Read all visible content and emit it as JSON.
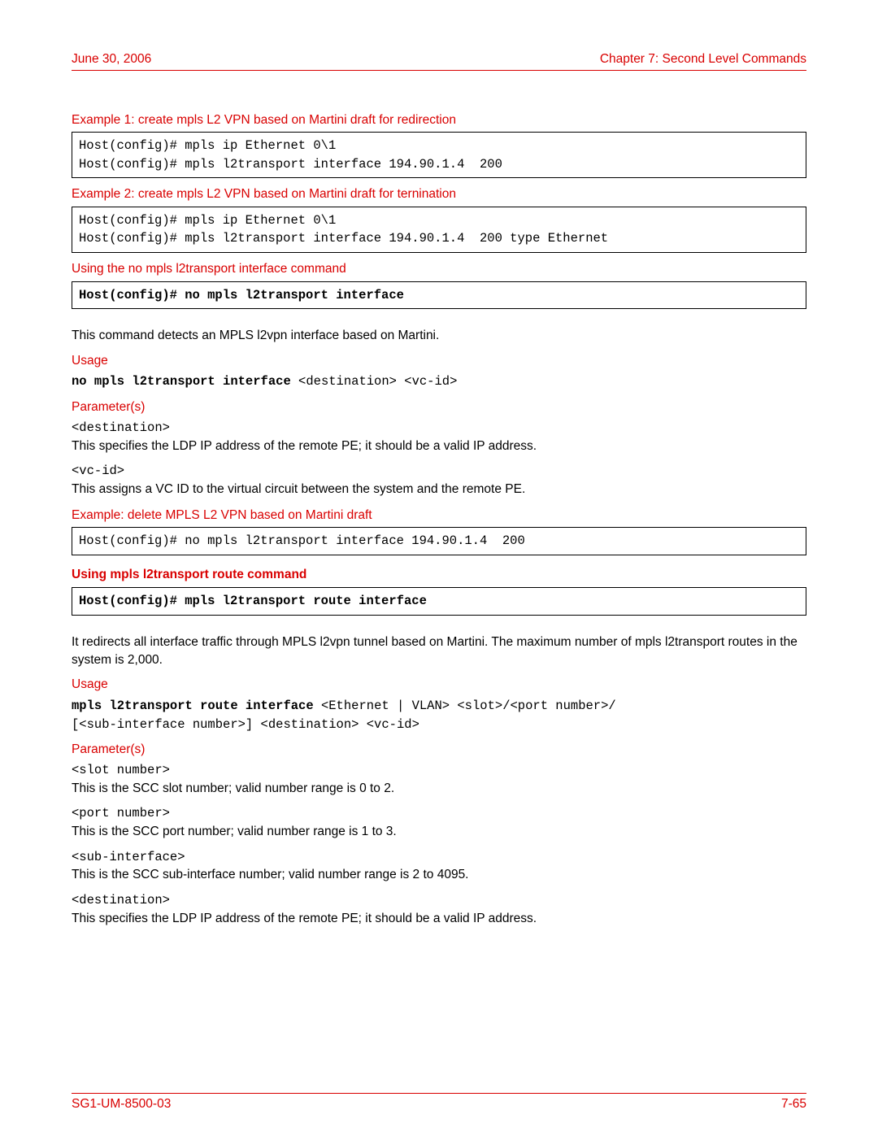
{
  "header": {
    "left": "June 30, 2006",
    "right": "Chapter 7: Second Level Commands"
  },
  "sections": {
    "ex1_heading": "Example 1: create mpls L2 VPN based on Martini draft for redirection",
    "ex1_code": "Host(config)# mpls ip Ethernet 0\\1\nHost(config)# mpls l2transport interface 194.90.1.4  200",
    "ex2_heading": "Example 2: create mpls L2 VPN based on Martini draft for ternination",
    "ex2_code": "Host(config)# mpls ip Ethernet 0\\1\nHost(config)# mpls l2transport interface 194.90.1.4  200 type Ethernet",
    "no_heading": "Using the no mpls l2transport interface command",
    "no_code": "Host(config)# no mpls l2transport interface",
    "no_desc": "This command detects an MPLS l2vpn interface based on Martini.",
    "usage_label_1": "Usage",
    "usage_1_bold": "no mpls l2transport interface ",
    "usage_1_rest": "<destination> <vc-id>",
    "params_label_1": "Parameter(s)",
    "param_dest": "<destination>",
    "param_dest_desc": "This specifies the LDP IP address of the remote PE; it should be a valid IP address.",
    "param_vcid": "<vc-id>",
    "param_vcid_desc": "This assigns a VC ID to the virtual circuit between the system and the remote PE.",
    "ex_del_heading": "Example: delete MPLS L2 VPN based on Martini draft",
    "ex_del_code": "Host(config)# no mpls l2transport interface 194.90.1.4  200",
    "route_title": "Using mpls l2transport route command",
    "route_code": "Host(config)# mpls l2transport route interface",
    "route_desc": "It redirects all interface traffic through MPLS l2vpn tunnel based on Martini. The maximum number of mpls l2transport routes in the system is 2,000.",
    "usage_label_2": "Usage",
    "usage_2_bold": "mpls l2transport route interface ",
    "usage_2_rest_line1": "<Ethernet | VLAN> <slot>/<port number>/",
    "usage_2_rest_line2": "[<sub-interface number>] <destination> <vc-id>",
    "params_label_2": "Parameter(s)",
    "param_slot": "<slot number>",
    "param_slot_desc": "This is the SCC slot number; valid number range is 0 to 2.",
    "param_port": "<port number>",
    "param_port_desc": "This is the SCC port number; valid number range is 1 to 3.",
    "param_subif": "<sub-interface>",
    "param_subif_desc": "This is the SCC sub-interface number; valid number range is 2 to 4095.",
    "param_dest2": "<destination>",
    "param_dest2_desc": "This specifies the LDP IP address of the remote PE; it should be a valid IP address."
  },
  "footer": {
    "left": "SG1-UM-8500-03",
    "right": "7-65"
  }
}
